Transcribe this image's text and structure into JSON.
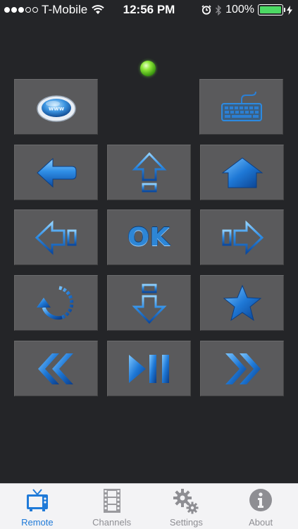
{
  "status_bar": {
    "carrier": "T-Mobile",
    "time": "12:56 PM",
    "battery": "100%",
    "signal_bars_filled": 3,
    "signal_bars_total": 5,
    "battery_level": 1.0
  },
  "remote": {
    "ok_label": "OK",
    "buttons": [
      {
        "id": "web",
        "icon": "www-globe-icon"
      },
      {
        "id": "keyboard",
        "icon": "keyboard-icon"
      },
      {
        "id": "back",
        "icon": "back-arrow-icon"
      },
      {
        "id": "up",
        "icon": "up-arrow-icon"
      },
      {
        "id": "home",
        "icon": "home-icon"
      },
      {
        "id": "left",
        "icon": "left-arrow-icon"
      },
      {
        "id": "ok",
        "icon": "ok-text"
      },
      {
        "id": "right",
        "icon": "right-arrow-icon"
      },
      {
        "id": "replay",
        "icon": "replay-icon"
      },
      {
        "id": "down",
        "icon": "down-arrow-icon"
      },
      {
        "id": "star",
        "icon": "star-icon"
      },
      {
        "id": "rewind",
        "icon": "rewind-icon"
      },
      {
        "id": "play-pause",
        "icon": "play-pause-icon"
      },
      {
        "id": "fast-forward",
        "icon": "fast-forward-icon"
      }
    ]
  },
  "tabs": [
    {
      "label": "Remote",
      "icon": "tv-icon",
      "active": true
    },
    {
      "label": "Channels",
      "icon": "film-strip-icon",
      "active": false
    },
    {
      "label": "Settings",
      "icon": "gears-icon",
      "active": false
    },
    {
      "label": "About",
      "icon": "info-icon",
      "active": false
    }
  ],
  "colors": {
    "background": "#242528",
    "button": "#5a5a5c",
    "accent_blue": "#1f7ad8",
    "led_green": "#6fd82a",
    "battery_green": "#4cd964",
    "tab_bar": "#f3f3f5",
    "tab_inactive": "#8e8e93"
  }
}
